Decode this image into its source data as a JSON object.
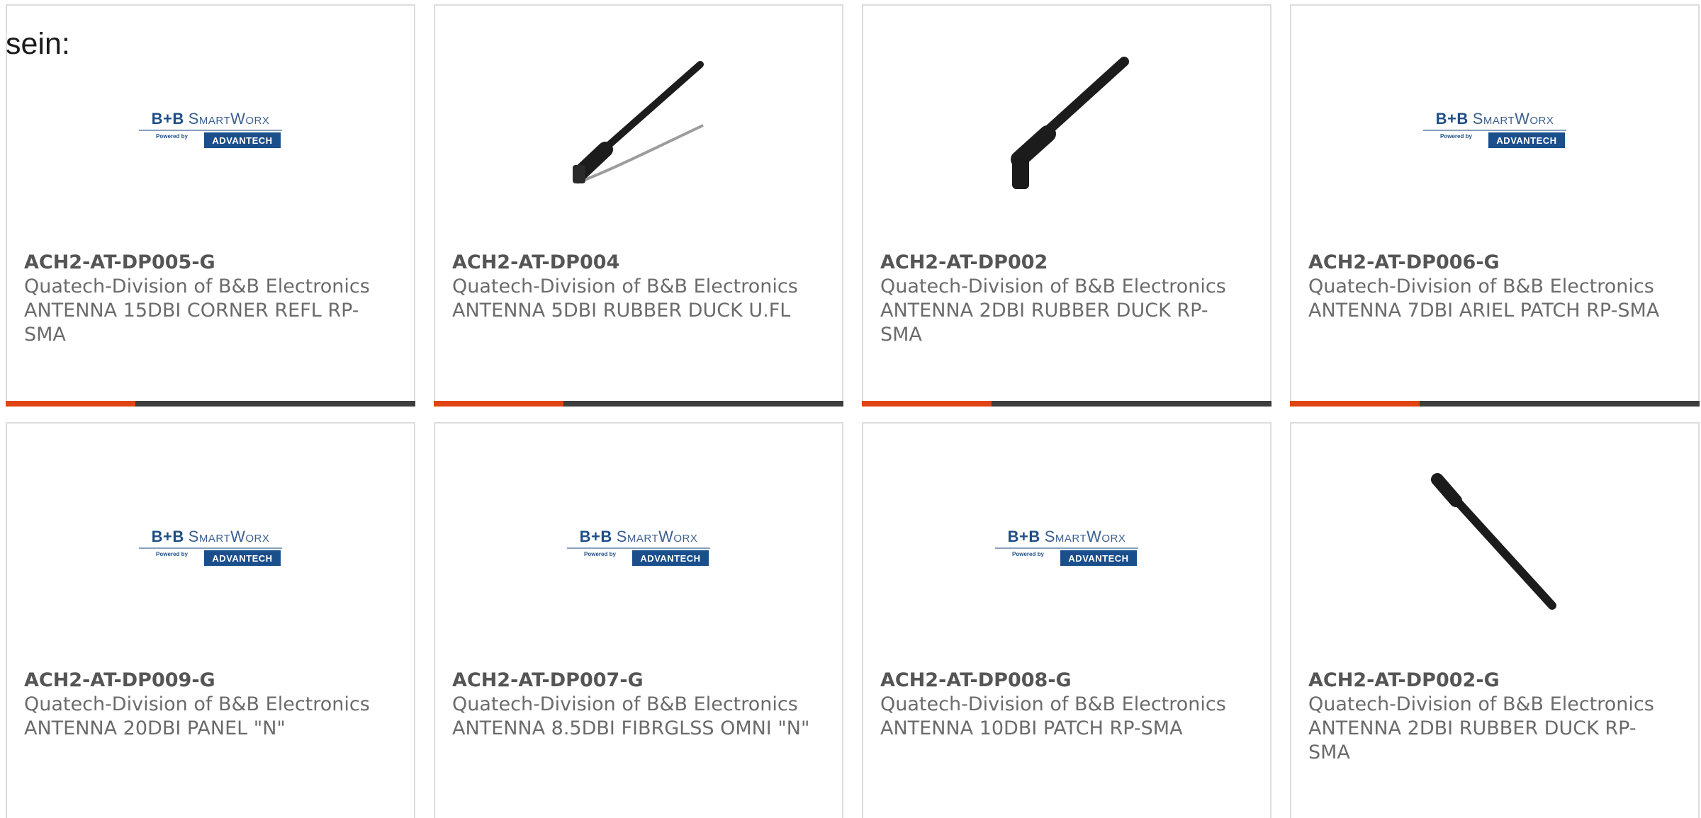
{
  "intro_text": "sein:",
  "logo": {
    "brand_mark": "B+B",
    "brand_name": "SmartWorx",
    "powered_by": "Powered by",
    "partner": "ADVANTECH"
  },
  "colors": {
    "accent": "#e04412",
    "bar": "#3d3d3d",
    "logo_blue": "#1a4f8c"
  },
  "products": [
    {
      "part_no": "ACH2-AT-DP005-G",
      "manufacturer": "Quatech-Division of B&B Electronics",
      "description": "ANTENNA 15DBI CORNER REFL RP-SMA",
      "image": "bb-smartworx-logo"
    },
    {
      "part_no": "ACH2-AT-DP004",
      "manufacturer": "Quatech-Division of B&B Electronics",
      "description": "ANTENNA 5DBI RUBBER DUCK U.FL",
      "image": "antenna-with-cable"
    },
    {
      "part_no": "ACH2-AT-DP002",
      "manufacturer": "Quatech-Division of B&B Electronics",
      "description": "ANTENNA 2DBI RUBBER DUCK RP-SMA",
      "image": "antenna-rubber-duck"
    },
    {
      "part_no": "ACH2-AT-DP006-G",
      "manufacturer": "Quatech-Division of B&B Electronics",
      "description": "ANTENNA 7DBI ARIEL PATCH RP-SMA",
      "image": "bb-smartworx-logo"
    },
    {
      "part_no": "ACH2-AT-DP009-G",
      "manufacturer": "Quatech-Division of B&B Electronics",
      "description": "ANTENNA 20DBI PANEL \"N\"",
      "image": "bb-smartworx-logo"
    },
    {
      "part_no": "ACH2-AT-DP007-G",
      "manufacturer": "Quatech-Division of B&B Electronics",
      "description": "ANTENNA 8.5DBI FIBRGLSS OMNI \"N\"",
      "image": "bb-smartworx-logo"
    },
    {
      "part_no": "ACH2-AT-DP008-G",
      "manufacturer": "Quatech-Division of B&B Electronics",
      "description": "ANTENNA 10DBI PATCH RP-SMA",
      "image": "bb-smartworx-logo"
    },
    {
      "part_no": "ACH2-AT-DP002-G",
      "manufacturer": "Quatech-Division of B&B Electronics",
      "description": "ANTENNA 2DBI RUBBER DUCK RP-SMA",
      "image": "antenna-stick"
    }
  ]
}
